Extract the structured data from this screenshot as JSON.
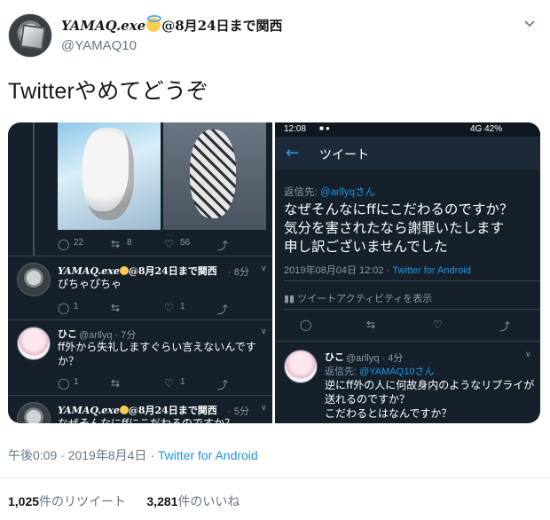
{
  "tweet": {
    "name_prefix": "YAMAQ.exe",
    "name_suffix": "@8月24日まで関西",
    "handle": "@YAMAQ10",
    "text": "Twitterやめてどうぞ",
    "time": "午後0:09",
    "date": "2019年8月4日",
    "separator": "·",
    "source": "Twitter for Android",
    "retweets_count": "1,025",
    "retweets_label": "件のリツイート",
    "likes_count": "3,281",
    "likes_label": "件のいいね"
  },
  "left_shot": {
    "row1": {
      "reply": "22",
      "retweet": "8",
      "like": "56"
    },
    "reply1": {
      "name_prefix": "YAMAQ.exe",
      "name_suffix": "@8月24日まで関西",
      "time": "· 8分",
      "text": "ぴちゃぴちゃ",
      "reply": "1",
      "like": "1"
    },
    "reply2": {
      "name": "ひこ",
      "handle": "@arllyq · 7分",
      "text_line1": "ff外から失礼しますぐらい言えないんです",
      "text_line2": "か？",
      "reply": "1",
      "like": "1"
    },
    "reply3": {
      "name_prefix": "YAMAQ.exe",
      "name_suffix": "@8月24日まで関西",
      "time": "· 5分",
      "text": "なぜそんなにffにこだわるのですか？"
    }
  },
  "right_shot": {
    "status_time": "12:08",
    "status_right": "4G  42%",
    "title": "ツイート",
    "reply_to_label": "返信先:",
    "reply_to_handle": "@arllyqさん",
    "text_line1": "なぜそんなにffにこだわるのですか？",
    "text_line2": "気分を害されたなら謝罪いたします",
    "text_line3": "申し訳ございませんでした",
    "timestamp": "2019年08月04日 12:02 ·",
    "source": "Twitter for Android",
    "activity": "ツイートアクティビティを表示",
    "reply": {
      "name": "ひこ",
      "handle": "@arllyq · 4分",
      "reply_to_label": "返信先:",
      "reply_to_handle": "@YAMAQ10さん",
      "text_line1": "逆にff外の人に何故身内のようなリプライが",
      "text_line2": "送れるのですか？",
      "text_line3": "こだわるとはなんですか？"
    }
  }
}
